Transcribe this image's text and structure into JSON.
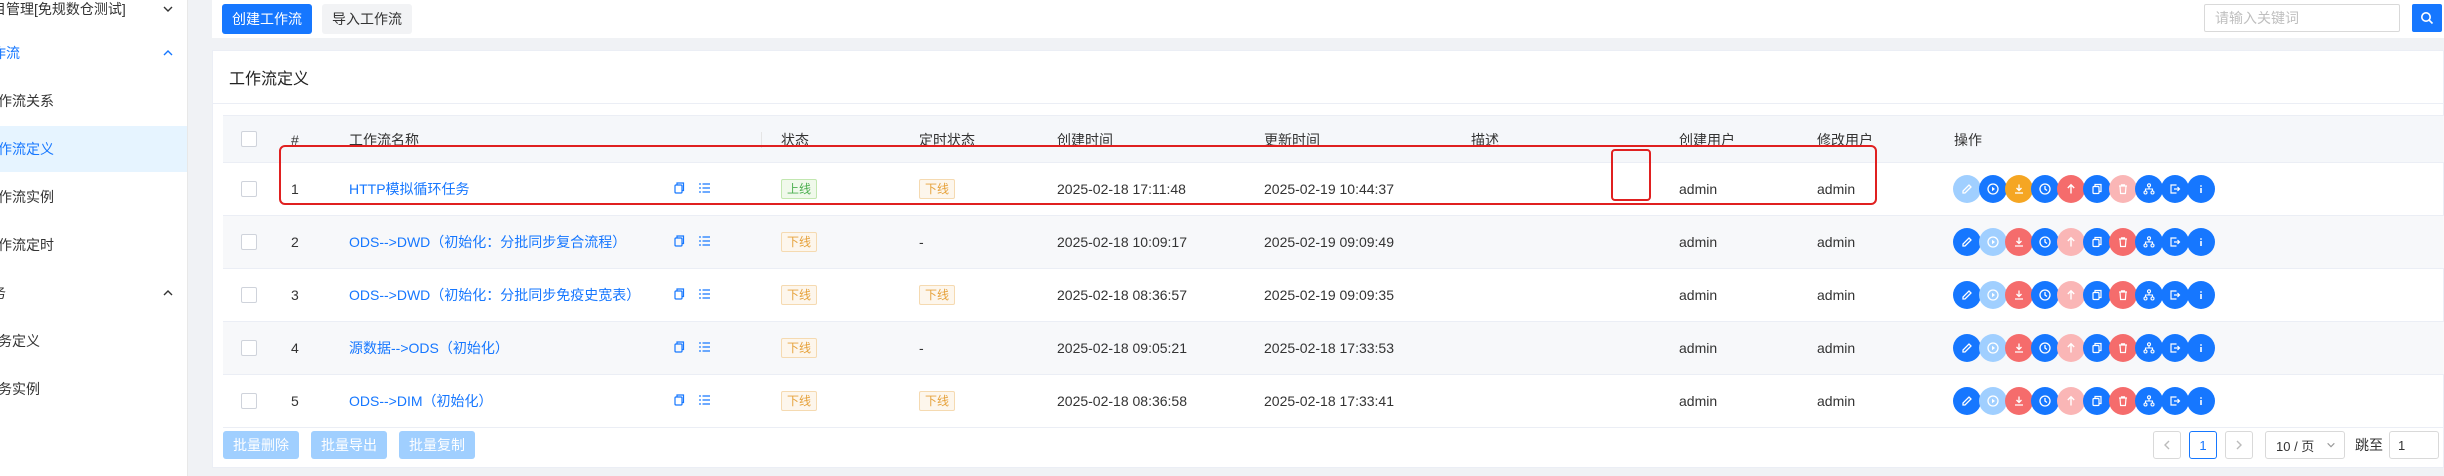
{
  "sidebar": {
    "items": [
      {
        "label": "目管理[免规数仓测试]",
        "type": "group"
      },
      {
        "label": "作流",
        "type": "group-open"
      },
      {
        "label": "作流关系",
        "type": "item"
      },
      {
        "label": "作流定义",
        "type": "item-active"
      },
      {
        "label": "作流实例",
        "type": "item"
      },
      {
        "label": "作流定时",
        "type": "item"
      },
      {
        "label": "务",
        "type": "group-plain"
      },
      {
        "label": "务定义",
        "type": "item"
      },
      {
        "label": "务实例",
        "type": "item"
      }
    ]
  },
  "toolbar": {
    "create_label": "创建工作流",
    "import_label": "导入工作流",
    "search_placeholder": "请输入关键词",
    "search_value": ""
  },
  "card": {
    "title": "工作流定义"
  },
  "table": {
    "columns": {
      "index": "#",
      "name": "工作流名称",
      "status": "状态",
      "schedule": "定时状态",
      "created": "创建时间",
      "updated": "更新时间",
      "desc": "描述",
      "creator": "创建用户",
      "modifier": "修改用户",
      "actions": "操作"
    },
    "rows": [
      {
        "index": "1",
        "name": "HTTP模拟循环任务",
        "status": "上线",
        "schedule": "下线",
        "created": "2025-02-18 17:11:48",
        "updated": "2025-02-19 10:44:37",
        "desc": "",
        "creator": "admin",
        "modifier": "admin"
      },
      {
        "index": "2",
        "name": "ODS-->DWD（初始化：分批同步复合流程）",
        "status": "下线",
        "schedule": "-",
        "created": "2025-02-18 10:09:17",
        "updated": "2025-02-19 09:09:49",
        "desc": "",
        "creator": "admin",
        "modifier": "admin"
      },
      {
        "index": "3",
        "name": "ODS-->DWD（初始化：分批同步免疫史宽表）",
        "status": "下线",
        "schedule": "下线",
        "created": "2025-02-18 08:36:57",
        "updated": "2025-02-19 09:09:35",
        "desc": "",
        "creator": "admin",
        "modifier": "admin"
      },
      {
        "index": "4",
        "name": "源数据-->ODS（初始化）",
        "status": "下线",
        "schedule": "-",
        "created": "2025-02-18 09:05:21",
        "updated": "2025-02-18 17:33:53",
        "desc": "",
        "creator": "admin",
        "modifier": "admin"
      },
      {
        "index": "5",
        "name": "ODS-->DIM（初始化）",
        "status": "下线",
        "schedule": "下线",
        "created": "2025-02-18 08:36:58",
        "updated": "2025-02-18 17:33:41",
        "desc": "",
        "creator": "admin",
        "modifier": "admin"
      }
    ],
    "action_icons": [
      "edit-icon",
      "run-icon",
      "publish-icon",
      "timing-icon",
      "online-icon",
      "copy-icon",
      "delete-icon",
      "tree-icon",
      "export-icon",
      "info-icon"
    ],
    "action_colors_online": [
      "#a0cfff",
      "#1677ff",
      "#f5a623",
      "#1677ff",
      "#f56c6c",
      "#1677ff",
      "#fab6b6",
      "#1677ff",
      "#1677ff",
      "#1677ff"
    ],
    "action_colors_offline": [
      "#1677ff",
      "#a0cfff",
      "#f56c6c",
      "#1677ff",
      "#fab6b6",
      "#1677ff",
      "#f56c6c",
      "#1677ff",
      "#1677ff",
      "#1677ff"
    ]
  },
  "footer": {
    "batch_delete": "批量删除",
    "batch_export": "批量导出",
    "batch_copy": "批量复制",
    "current_page": "1",
    "page_size": "10 / 页",
    "jump_label": "跳至",
    "jump_value": "1"
  }
}
